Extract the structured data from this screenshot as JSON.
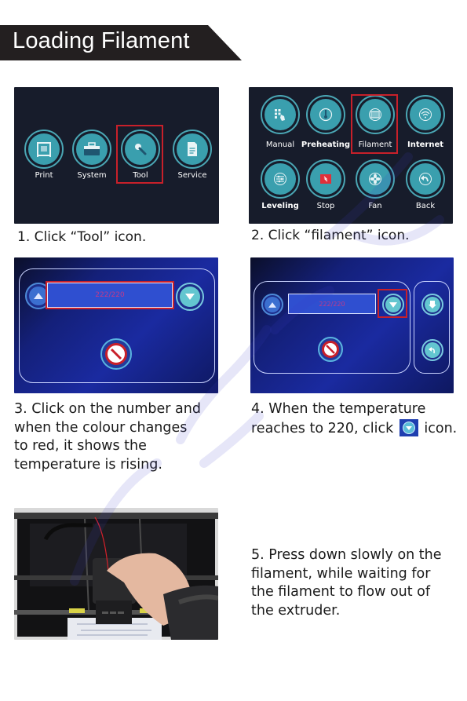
{
  "header": {
    "title": "Loading Filament"
  },
  "steps": [
    {
      "caption": "1. Click “Tool” icon.",
      "screen": {
        "buttons": [
          {
            "label": "Print",
            "icon": "printer-icon"
          },
          {
            "label": "System",
            "icon": "toolbox-icon"
          },
          {
            "label": "Tool",
            "icon": "wrench-icon",
            "highlighted": true
          },
          {
            "label": "Service",
            "icon": "document-icon"
          }
        ]
      }
    },
    {
      "caption": "2. Click “filament” icon.",
      "screen": {
        "buttons": [
          {
            "label": "Manual",
            "icon": "keypad-touch-icon"
          },
          {
            "label": "Preheating",
            "icon": "thermometer-icon"
          },
          {
            "label": "Filament",
            "icon": "filament-spool-icon",
            "highlighted": true
          },
          {
            "label": "Internet",
            "icon": "wifi-icon"
          },
          {
            "label": "Leveling",
            "icon": "sliders-icon"
          },
          {
            "label": "Stop",
            "icon": "stop-icon"
          },
          {
            "label": "Fan",
            "icon": "fan-icon"
          },
          {
            "label": "Back",
            "icon": "back-arrow-icon"
          }
        ]
      }
    },
    {
      "caption": "3. Click on the number and when the colour changes to red, it shows the temperature is rising.",
      "caption_lines": [
        "3. Click on the number and",
        "when the colour changes",
        "to red, it shows the",
        "temperature is rising."
      ],
      "screen": {
        "temperature": "222/220"
      }
    },
    {
      "caption_line1": "4. When the temperature",
      "caption_line2_before": "reaches to 220, click",
      "caption_line2_after": "icon.",
      "screen": {
        "temperature": "222/220"
      }
    },
    {
      "caption_lines": [
        "5. Press down slowly on the",
        "filament, while waiting for",
        "the filament to flow out of",
        "the extruder."
      ]
    }
  ],
  "colors": {
    "highlight": "#c8202a",
    "button_teal": "#3a9fae",
    "screen_dark": "#171c2b",
    "banner": "#231f20"
  }
}
